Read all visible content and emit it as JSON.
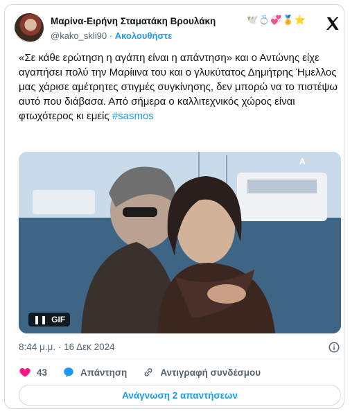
{
  "author": {
    "name": "Μαρίνα-Ειρήνη Σταματάκη Βρουλάκη",
    "emojis": "🕊️💍💞🏅⭐",
    "handle": "@kako_skli90",
    "separator": "·",
    "follow_label": "Ακολουθήστε"
  },
  "tweet": {
    "text": "«Σε κάθε ερώτηση η αγάπη είναι η απάντηση» και ο Αντώνης είχε αγαπήσει πολύ την Μαρίιινα του και ο γλυκύτατος Δημήτρης Ήμελλος μας χάρισε αμέτρητες στιγμές συγκίνησης, δεν μπορώ να το πιστέψω αυτό που διάβασα. Από σήμερα ο καλλιτεχνικός χώρος είναι φτωχότερος κι εμείς ",
    "hashtag": "#sasmos"
  },
  "media": {
    "badge_label": "GIF",
    "pause_glyph": "❚❚"
  },
  "meta": {
    "timestamp": "8:44 μ.μ. · 16 Δεκ 2024"
  },
  "actions": {
    "like_count": "43",
    "reply_label": "Απάντηση",
    "copy_link_label": "Αντιγραφή συνδέσμου"
  },
  "read_replies_label": "Ανάγνωση 2 απαντήσεων",
  "colors": {
    "accent": "#1d9bf0",
    "like": "#f91880",
    "muted": "#536471"
  }
}
